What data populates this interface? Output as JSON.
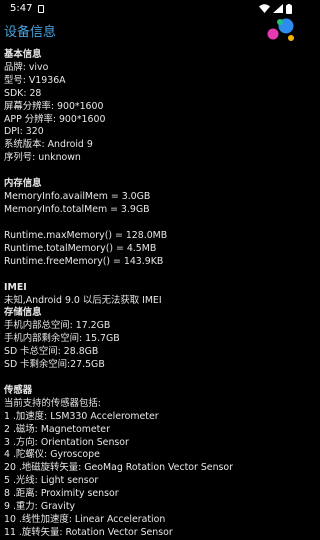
{
  "status_bar": {
    "time": "5:47",
    "colors": {
      "icons": "#ffffff"
    }
  },
  "app_bar": {
    "title": "设备信息",
    "title_color": "#4aa3df",
    "logo": "colorful-dots-logo"
  },
  "basic": {
    "title": "基本信息",
    "lines": [
      "品牌: vivo",
      "型号: V1936A",
      "SDK:  28",
      "屏幕分辨率: 900*1600",
      "APP 分辨率: 900*1600",
      "DPI: 320",
      "系统版本: Android 9",
      "序列号: unknown"
    ]
  },
  "memory": {
    "title": "内存信息",
    "info_lines": [
      "MemoryInfo.availMem = 3.0GB",
      "MemoryInfo.totalMem = 3.9GB"
    ],
    "runtime_lines": [
      "Runtime.maxMemory() = 128.0MB",
      "Runtime.totalMemory() = 4.5MB",
      "Runtime.freeMemory() = 143.9KB"
    ]
  },
  "imei": {
    "title": "IMEI",
    "line": "未知,Android 9.0 以后无法获取 IMEI"
  },
  "storage": {
    "title": "存储信息",
    "lines": [
      "手机内部总空间: 17.2GB",
      "手机内部剩余空间: 15.7GB",
      "SD 卡总空间: 28.8GB",
      "SD 卡剩余空间:27.5GB"
    ]
  },
  "sensors": {
    "title": "传感器",
    "subtitle": "当前支持的传感器包括:",
    "lines": [
      "1 .加速度:  LSM330 Accelerometer",
      "2 .磁场:  Magnetometer",
      "3 .方向:  Orientation Sensor",
      "4 .陀螺仪:  Gyroscope",
      "20 .地磁旋转矢量:  GeoMag Rotation Vector Sensor",
      "5 .光线:  Light sensor",
      "8 .距离:  Proximity sensor",
      "9 .重力:  Gravity",
      "10 .线性加速度:  Linear Acceleration",
      "11 .旋转矢量:  Rotation Vector Sensor"
    ]
  }
}
